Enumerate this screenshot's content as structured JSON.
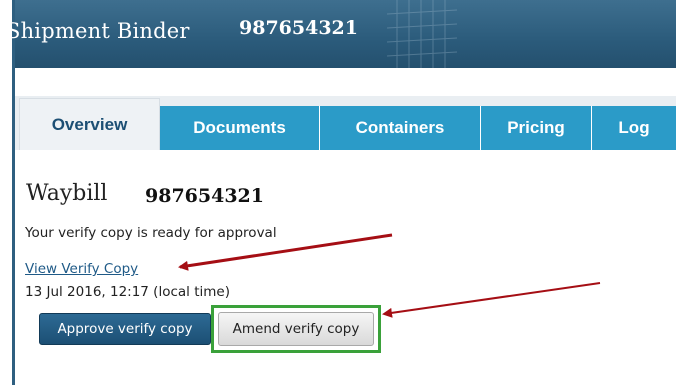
{
  "header": {
    "title": "Shipment Binder",
    "number": "987654321"
  },
  "tabs": [
    {
      "label": "Overview",
      "active": true
    },
    {
      "label": "Documents",
      "active": false
    },
    {
      "label": "Containers",
      "active": false
    },
    {
      "label": "Pricing",
      "active": false
    },
    {
      "label": "Log",
      "active": false
    }
  ],
  "content": {
    "heading": "Waybill",
    "waybill_number": "987654321",
    "status_text": "Your verify copy is ready for approval",
    "view_link": "View Verify Copy",
    "timestamp": "13 Jul 2016, 12:17 (local time)",
    "approve_label": "Approve verify copy",
    "amend_label": "Amend verify copy"
  },
  "colors": {
    "header_bg": "#2b5b7b",
    "tab_bg": "#2b9bc8",
    "active_tab_text": "#1c4f74",
    "primary_button": "#1c4f74",
    "highlight": "#3aa13a",
    "annotation_arrow": "#a50e14"
  }
}
